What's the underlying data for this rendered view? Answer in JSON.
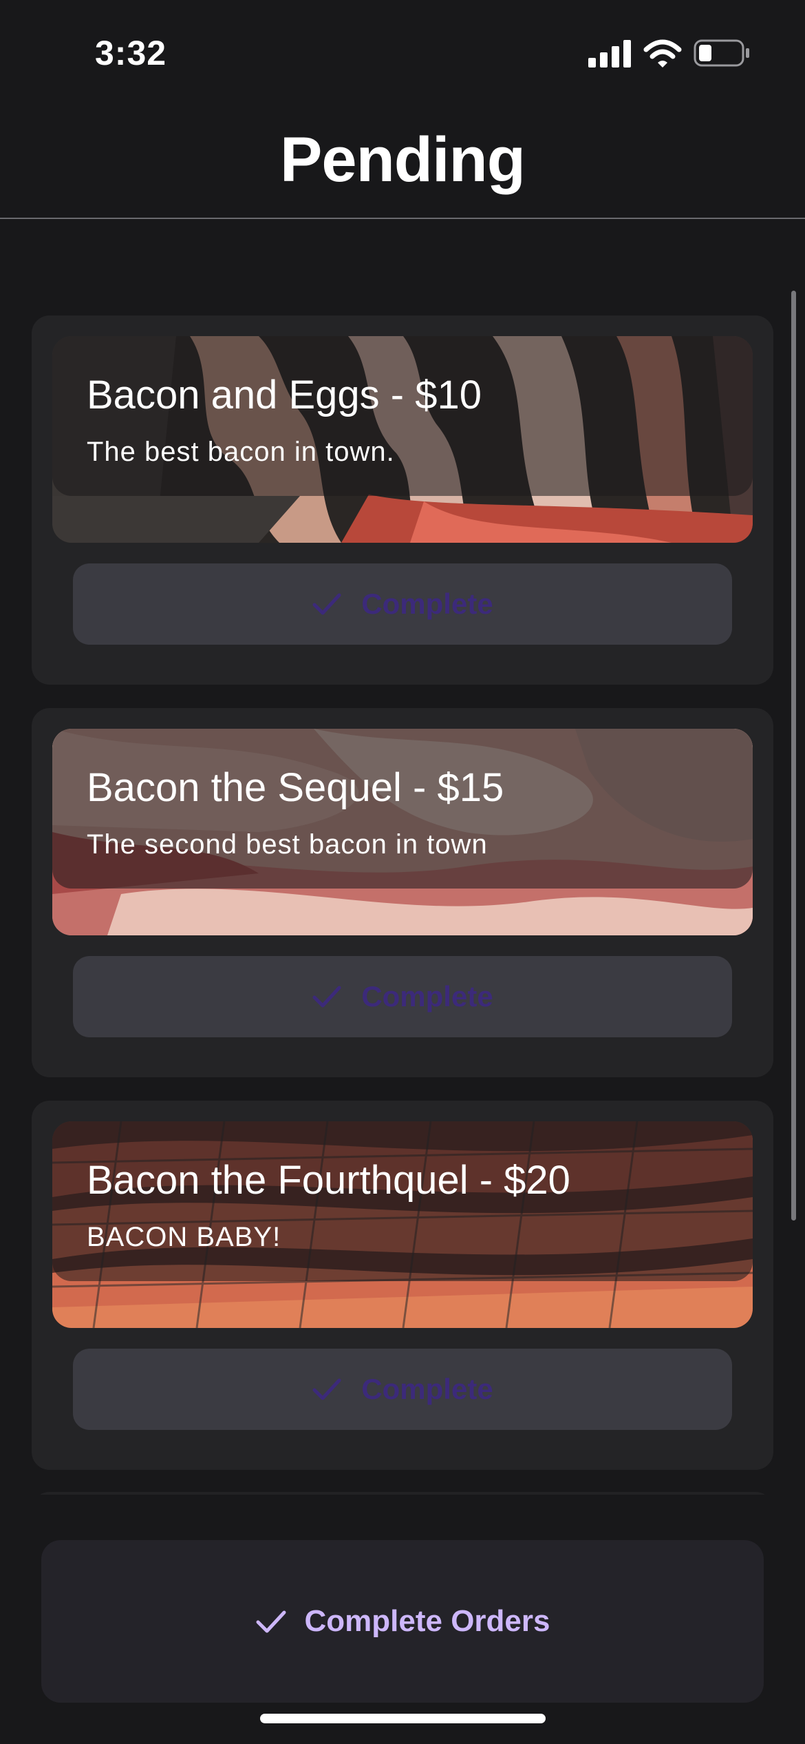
{
  "status_bar": {
    "time": "3:32",
    "icons": [
      "signal-icon",
      "wifi-icon",
      "battery-icon"
    ]
  },
  "header": {
    "title": "Pending"
  },
  "orders": [
    {
      "title": "Bacon and Eggs - $10",
      "description": "The best bacon in town.",
      "button_label": "Complete",
      "image": "bacon-in-pan"
    },
    {
      "title": "Bacon the Sequel - $15",
      "description": "The second best bacon in town",
      "button_label": "Complete",
      "image": "raw-bacon"
    },
    {
      "title": "Bacon the Fourthquel - $20",
      "description": "BACON BABY!",
      "button_label": "Complete",
      "image": "bacon-on-rack"
    }
  ],
  "footer": {
    "button_label": "Complete Orders"
  },
  "colors": {
    "background": "#18181a",
    "card": "#242426",
    "button": "#3b3b42",
    "button_text": "#3c2a7a",
    "accent": "#cdb7fb"
  }
}
